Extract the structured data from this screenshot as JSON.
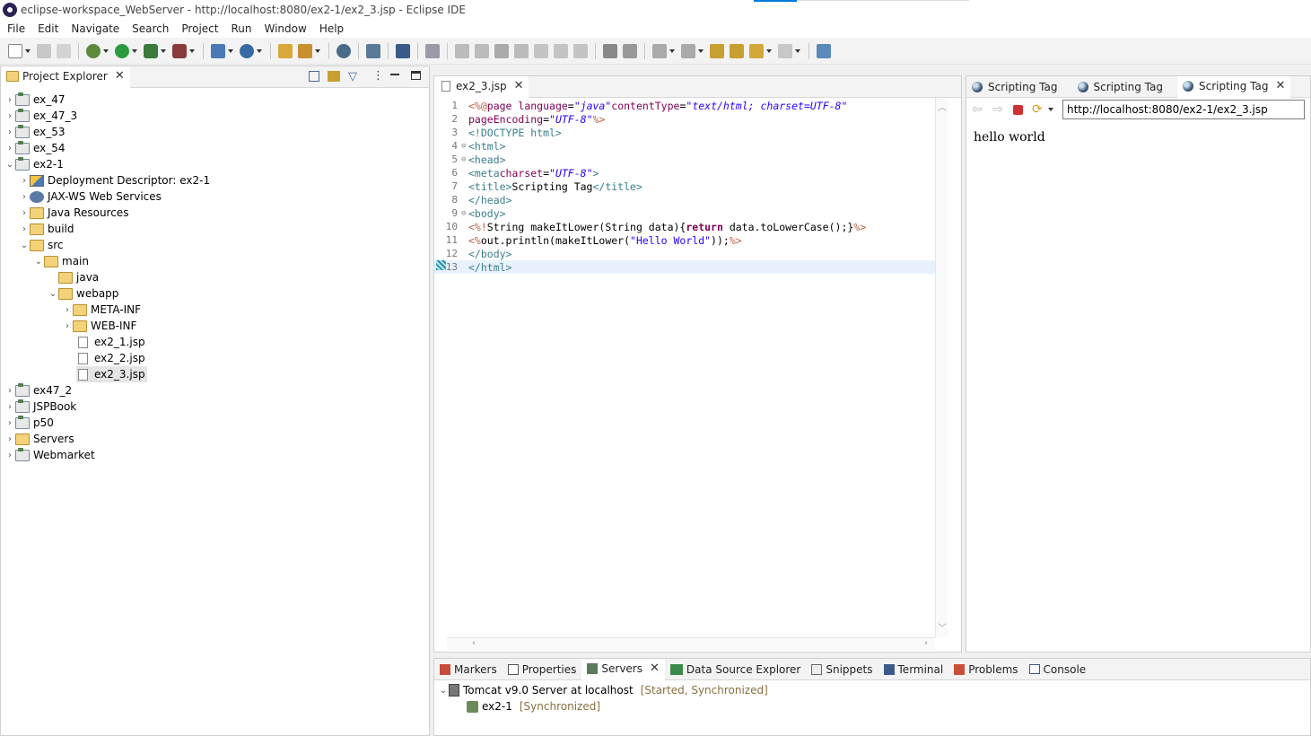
{
  "window": {
    "title": "eclipse-workspace_WebServer - http://localhost:8080/ex2-1/ex2_3.jsp - Eclipse IDE"
  },
  "menu": [
    "File",
    "Edit",
    "Navigate",
    "Search",
    "Project",
    "Run",
    "Window",
    "Help"
  ],
  "project_explorer": {
    "tab_label": "Project Explorer",
    "items": [
      {
        "label": "ex_47",
        "type": "project",
        "expanded": false
      },
      {
        "label": "ex_47_3",
        "type": "project",
        "expanded": false
      },
      {
        "label": "ex_53",
        "type": "project",
        "expanded": false
      },
      {
        "label": "ex_54",
        "type": "project",
        "expanded": false
      },
      {
        "label": "ex2-1",
        "type": "project",
        "expanded": true
      },
      {
        "label": "Deployment Descriptor: ex2-1",
        "type": "descriptor",
        "expanded": false
      },
      {
        "label": "JAX-WS Web Services",
        "type": "service",
        "expanded": false
      },
      {
        "label": "Java Resources",
        "type": "resources",
        "expanded": false
      },
      {
        "label": "build",
        "type": "folder",
        "expanded": false
      },
      {
        "label": "src",
        "type": "folder",
        "expanded": true
      },
      {
        "label": "main",
        "type": "folder",
        "expanded": true
      },
      {
        "label": "java",
        "type": "folder",
        "expanded": false
      },
      {
        "label": "webapp",
        "type": "folder",
        "expanded": true
      },
      {
        "label": "META-INF",
        "type": "folder",
        "expanded": false
      },
      {
        "label": "WEB-INF",
        "type": "folder",
        "expanded": false
      },
      {
        "label": "ex2_1.jsp",
        "type": "file"
      },
      {
        "label": "ex2_2.jsp",
        "type": "file"
      },
      {
        "label": "ex2_3.jsp",
        "type": "file",
        "selected": true
      },
      {
        "label": "ex47_2",
        "type": "project",
        "expanded": false
      },
      {
        "label": "JSPBook",
        "type": "project",
        "expanded": false
      },
      {
        "label": "p50",
        "type": "project",
        "expanded": false
      },
      {
        "label": "Servers",
        "type": "folder",
        "expanded": false
      },
      {
        "label": "Webmarket",
        "type": "project",
        "expanded": false
      }
    ]
  },
  "editor": {
    "tab_label": "ex2_3.jsp",
    "line_numbers": [
      "1",
      "2",
      "3",
      "4",
      "5",
      "6",
      "7",
      "8",
      "9",
      "10",
      "11",
      "12",
      "13"
    ]
  },
  "browser": {
    "tabs": [
      "Scripting Tag",
      "Scripting Tag",
      "Scripting Tag"
    ],
    "url": "http://localhost:8080/ex2-1/ex2_3.jsp",
    "content": "hello world"
  },
  "bottom_panel": {
    "tabs": [
      "Markers",
      "Properties",
      "Servers",
      "Data Source Explorer",
      "Snippets",
      "Terminal",
      "Problems",
      "Console"
    ],
    "server": {
      "name": "Tomcat v9.0 Server at localhost",
      "status": "[Started, Synchronized]",
      "module": "ex2-1",
      "module_status": "[Synchronized]"
    }
  }
}
